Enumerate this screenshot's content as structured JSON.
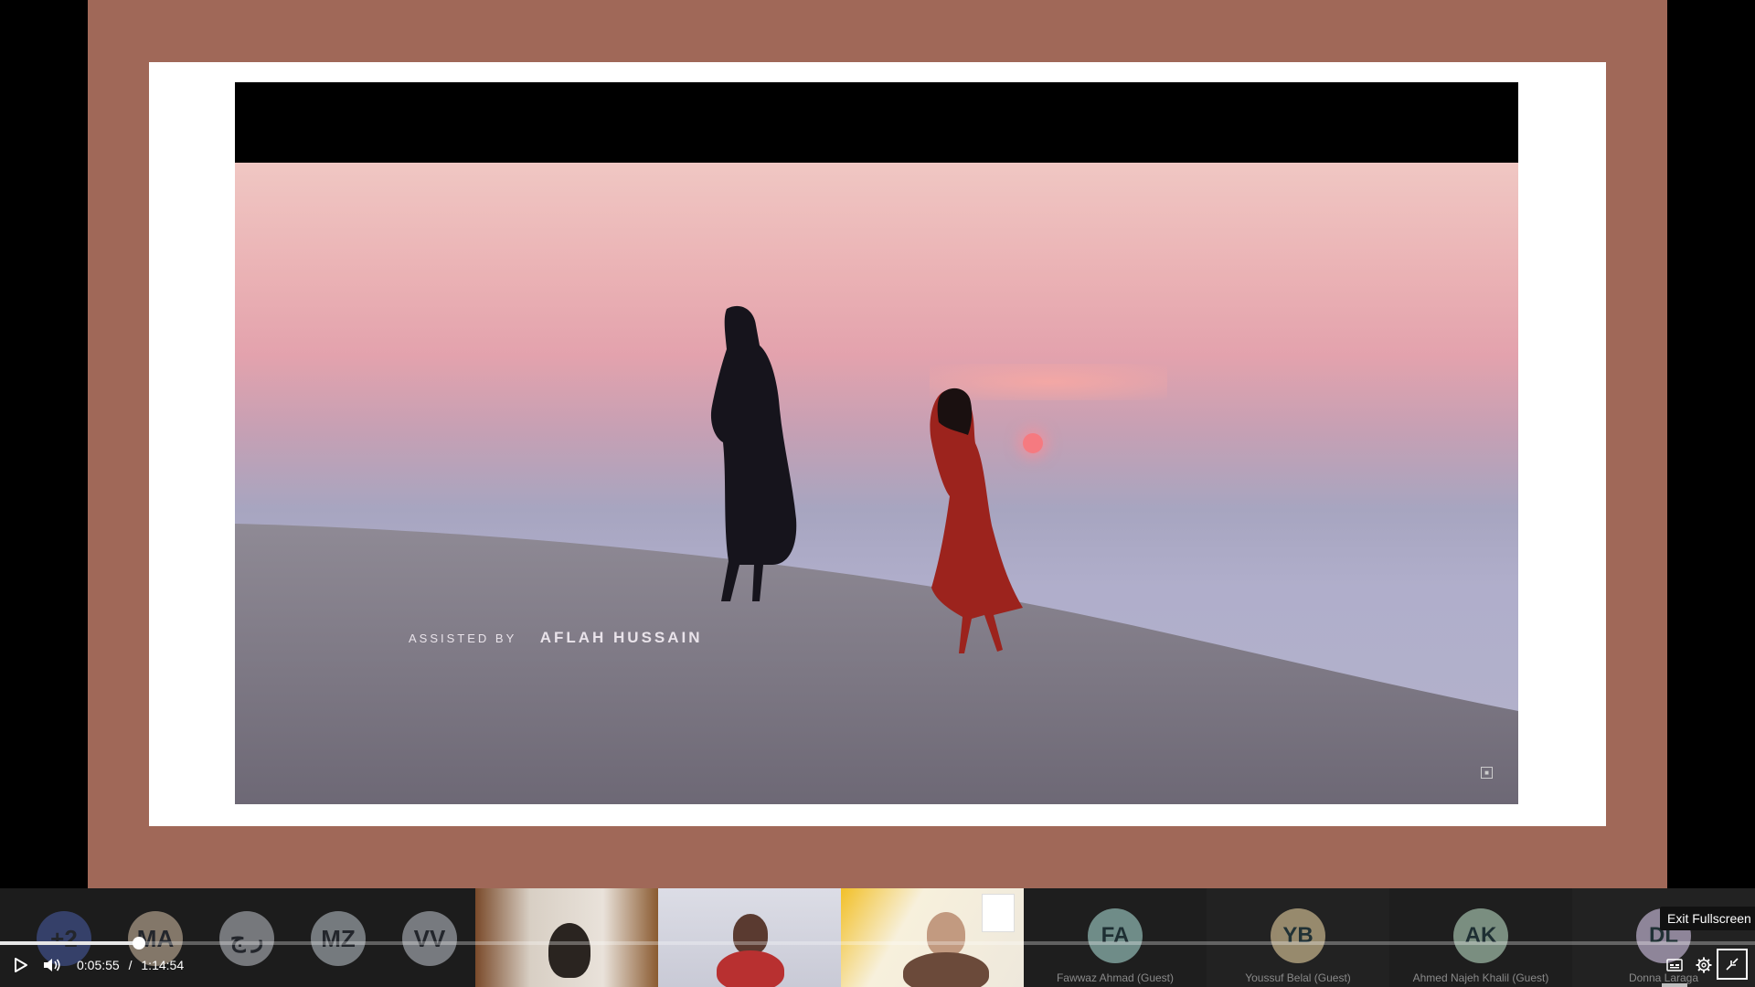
{
  "slide": {
    "credit_small": "ASSISTED BY",
    "credit_name": "AFLAH HUSSAIN"
  },
  "participants": {
    "avatars": [
      {
        "initials": "+2",
        "color": "#4b5ea8"
      },
      {
        "initials": "MA",
        "color": "#d8c2a8"
      },
      {
        "initials": "ر ج",
        "color": "#c0c4cc"
      },
      {
        "initials": "MZ",
        "color": "#bfc7ce"
      },
      {
        "initials": "VV",
        "color": "#c3c8d0"
      }
    ],
    "guest_tiles": [
      {
        "initials": "FA",
        "name": "Fawwaz Ahmad (Guest)",
        "color": "#a6d6cf"
      },
      {
        "initials": "YB",
        "name": "Youssuf Belal (Guest)",
        "color": "#e6cfa0"
      },
      {
        "initials": "AK",
        "name": "Ahmed Najeh Khalil (Guest)",
        "color": "#b7d9c2"
      },
      {
        "initials": "DL",
        "name": "Donna Laraga",
        "color": "#d6c7e8"
      }
    ]
  },
  "player": {
    "current_time": "0:05:55",
    "separator": "/",
    "duration": "1:14:54",
    "progress_fraction": 0.079,
    "tooltip": "Exit Fullscreen"
  }
}
